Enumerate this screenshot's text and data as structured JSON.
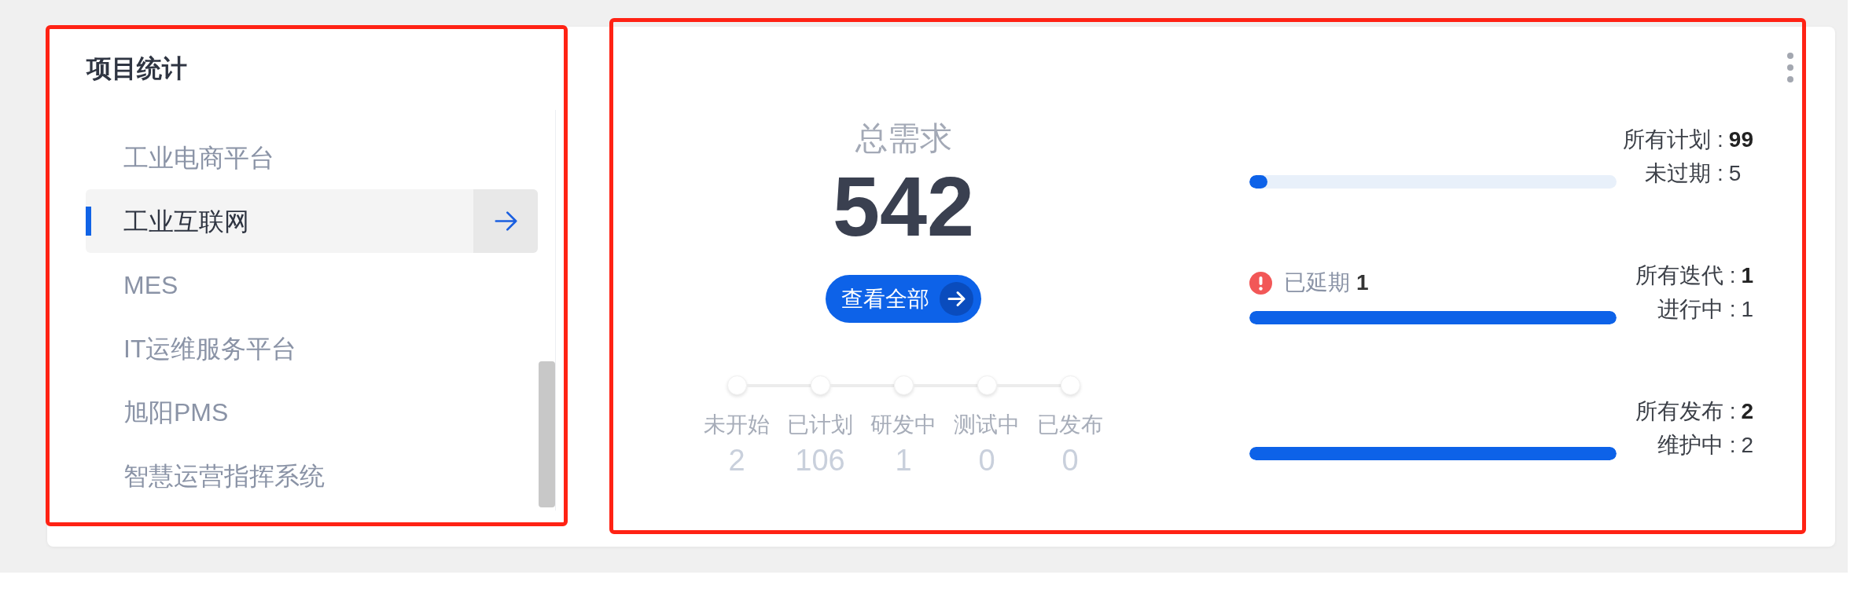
{
  "project_panel": {
    "title": "项目统计",
    "annotated": true,
    "projects": [
      {
        "name": "工业电商平台",
        "selected": false
      },
      {
        "name": "工业互联网",
        "selected": true
      },
      {
        "name": "MES",
        "selected": false
      },
      {
        "name": "IT运维服务平台",
        "selected": false
      },
      {
        "name": "旭阳PMS",
        "selected": false
      },
      {
        "name": "智慧运营指挥系统",
        "selected": false
      }
    ]
  },
  "summary_panel": {
    "annotated": true,
    "total": {
      "label": "总需求",
      "value": "542"
    },
    "view_all_button": "查看全部",
    "stages": [
      {
        "label": "未开始",
        "count": "2"
      },
      {
        "label": "已计划",
        "count": "106"
      },
      {
        "label": "研发中",
        "count": "1"
      },
      {
        "label": "测试中",
        "count": "0"
      },
      {
        "label": "已发布",
        "count": "0"
      }
    ],
    "metrics": [
      {
        "kind": "plain",
        "lines": [
          {
            "kind": "total",
            "label": "所有计划 :",
            "value": "99"
          },
          {
            "kind": "sub",
            "label": "未过期 :",
            "value": "5"
          }
        ],
        "level": 0.05
      },
      {
        "kind": "overdue",
        "alert": {
          "label": "已延期",
          "count": "1"
        },
        "lines": [
          {
            "kind": "total",
            "label": "所有迭代 :",
            "value": "1"
          },
          {
            "kind": "sub",
            "label": "进行中 :",
            "value": "1"
          }
        ],
        "level": 1
      },
      {
        "kind": "plain",
        "lines": [
          {
            "kind": "total",
            "label": "所有发布 :",
            "value": "2"
          },
          {
            "kind": "sub",
            "label": "维护中 :",
            "value": "2"
          }
        ],
        "level": 1
      }
    ]
  }
}
